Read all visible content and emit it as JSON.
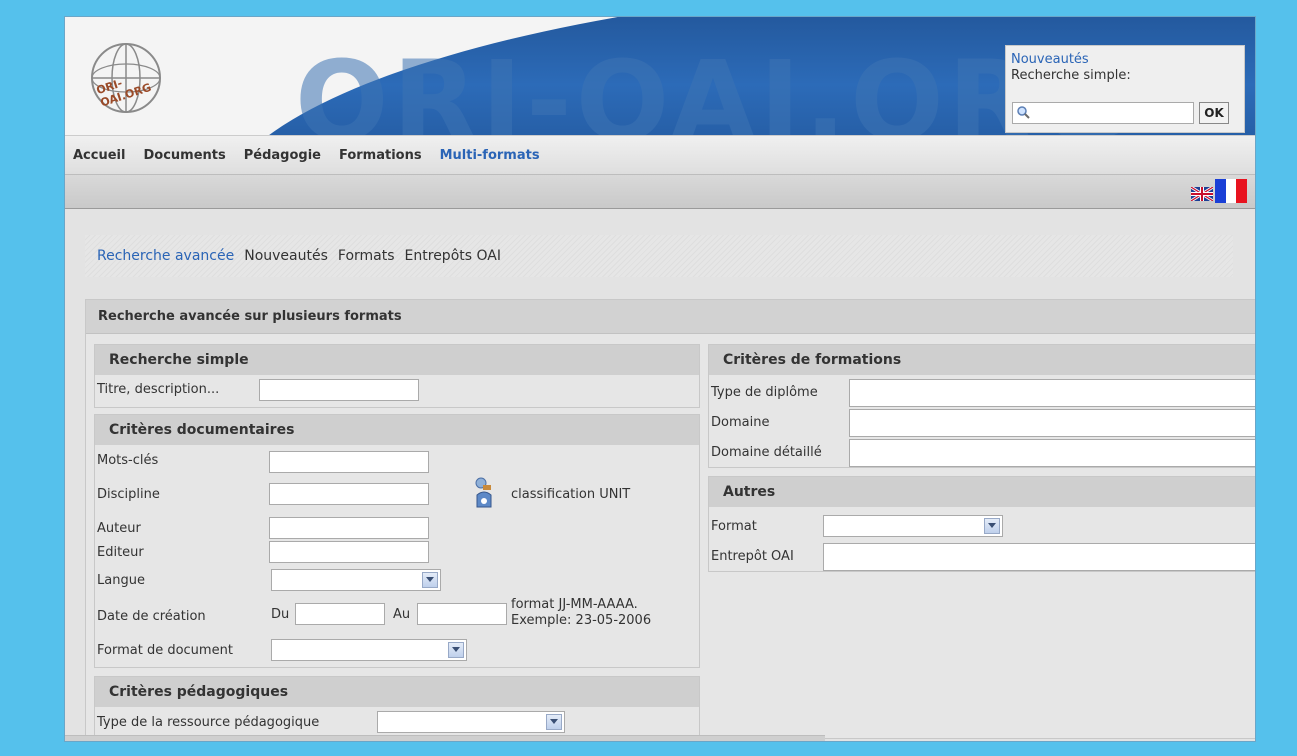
{
  "header": {
    "logo_text": "ORI-OAI.ORG",
    "banner_text": "ORI-OAI.ORG",
    "quick_link": "Nouveautés",
    "quick_label": "Recherche simple:",
    "quick_placeholder": "",
    "ok_label": "OK"
  },
  "nav": {
    "items": [
      "Accueil",
      "Documents",
      "Pédagogie",
      "Formations",
      "Multi-formats"
    ],
    "active": "Multi-formats"
  },
  "subnav": {
    "items": [
      "Recherche avancée",
      "Nouveautés",
      "Formats",
      "Entrepôts OAI"
    ],
    "active": "Recherche avancée"
  },
  "panel": {
    "title": "Recherche avancée sur plusieurs formats"
  },
  "simple": {
    "title": "Recherche simple",
    "field_label": "Titre, description..."
  },
  "documentaires": {
    "title": "Critères documentaires",
    "mots_cles": "Mots-clés",
    "discipline": "Discipline",
    "classification": "classification UNIT",
    "auteur": "Auteur",
    "editeur": "Editeur",
    "langue": "Langue",
    "date_creation": "Date de création",
    "du": "Du",
    "au": "Au",
    "date_hint_1": "format JJ-MM-AAAA.",
    "date_hint_2": "Exemple: 23-05-2006",
    "format_document": "Format de document"
  },
  "pedagogiques": {
    "title": "Critères pédagogiques",
    "type_ressource": "Type de la ressource pédagogique"
  },
  "formations": {
    "title": "Critères de formations",
    "type_diplome": "Type de diplôme",
    "domaine": "Domaine",
    "domaine_detaille": "Domaine détaillé"
  },
  "autres": {
    "title": "Autres",
    "format": "Format",
    "entrepot": "Entrepôt OAI"
  },
  "colors": {
    "page_bg": "#55c1ec",
    "link": "#2a64b6",
    "banner": "#2c6bb8"
  }
}
